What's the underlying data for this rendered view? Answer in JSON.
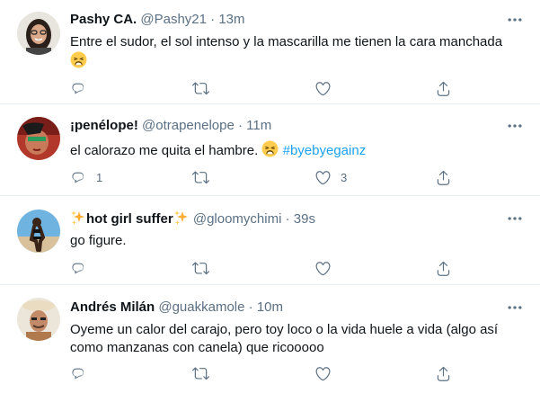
{
  "colors": {
    "link": "#1da1f2",
    "secondary": "#5b7083",
    "text": "#0f1419",
    "divider": "#e6ecf0"
  },
  "tweets": [
    {
      "name": "Pashy CA.",
      "handle": "@Pashy21",
      "dot": "·",
      "time": "13m",
      "text": "Entre el sudor, el sol intenso y la mascarilla me tienen la cara manchada",
      "emoji": "weary-face-emoji",
      "reply_count": "",
      "retweet_count": "",
      "like_count": ""
    },
    {
      "name": "¡penélope!",
      "handle": "@otrapenelope",
      "dot": "·",
      "time": "11m",
      "text": "el calorazo me quita el hambre.",
      "emoji": "weary-face-emoji",
      "hashtag": "#byebyegainz",
      "reply_count": "1",
      "retweet_count": "",
      "like_count": "3"
    },
    {
      "name": "hot girl suffer",
      "name_decoration": "sparkles-emoji",
      "handle": "@gloomychimi",
      "dot": "·",
      "time": "39s",
      "text": "go figure.",
      "reply_count": "",
      "retweet_count": "",
      "like_count": ""
    },
    {
      "name": "Andrés Milán",
      "handle": "@guakkamole",
      "dot": "·",
      "time": "10m",
      "text_line1": "Oyeme un calor del carajo, pero toy loco o la vida huele a vida (algo así",
      "text_line2": "como manzanas con canela) que ricooooo",
      "reply_count": "",
      "retweet_count": "",
      "like_count": ""
    }
  ],
  "icons": [
    "reply-icon",
    "retweet-icon",
    "like-icon",
    "share-icon",
    "more-icon"
  ]
}
